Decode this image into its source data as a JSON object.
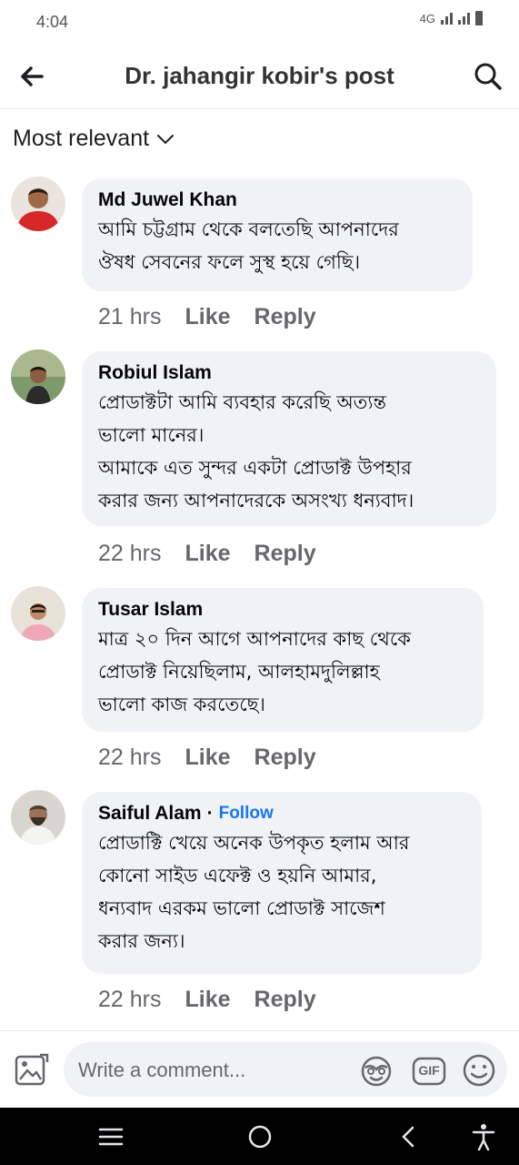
{
  "status": {
    "time": "4:04",
    "network": "4G"
  },
  "header": {
    "title": "Dr. jahangir kobir's post"
  },
  "sort": {
    "label": "Most relevant"
  },
  "comments": [
    {
      "author": "Md Juwel Khan",
      "text": "আমি চট্টগ্রাম থেকে বলতেছি আপনাদের\nঔষধ সেবনের ফলে সুস্থ হয়ে গেছি।",
      "time": "21 hrs",
      "like": "Like",
      "reply": "Reply"
    },
    {
      "author": "Robiul Islam",
      "text": "প্রোডাক্টটা আমি ব্যবহার করেছি অত্যন্ত\nভালো মানের।\nআমাকে এত সুন্দর একটা প্রোডাক্ট উপহার\nকরার জন্য আপনাদেরকে অসংখ্য ধন্যবাদ।",
      "time": "22 hrs",
      "like": "Like",
      "reply": "Reply"
    },
    {
      "author": "Tusar Islam",
      "text": "মাত্র ২০ দিন আগে আপনাদের কাছ থেকে\nপ্রোডাক্ট নিয়েছিলাম, আলহামদুলিল্লাহ\nভালো কাজ করতেছে।",
      "time": "22 hrs",
      "like": "Like",
      "reply": "Reply"
    },
    {
      "author": "Saiful Alam",
      "separator": "·",
      "follow": "Follow",
      "text": "প্রোডাক্টি খেয়ে অনেক উপকৃত হলাম আর\nকোনো সাইড এফেক্ট ও হয়নি আমার,\nধন্যবাদ এরকম ভালো প্রোডাক্ট সাজেশ\nকরার জন্য।",
      "time": "22 hrs",
      "like": "Like",
      "reply": "Reply"
    }
  ],
  "composer": {
    "placeholder": "Write a comment...",
    "gif_label": "GIF"
  },
  "colors": {
    "bubble": "#f0f2f5",
    "secondary_text": "#65676b",
    "link": "#1877f2"
  }
}
